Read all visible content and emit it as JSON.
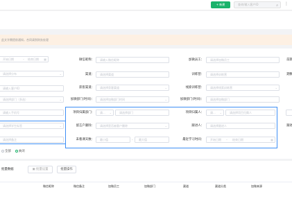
{
  "header": {
    "new_button": "+ 新建",
    "search_placeholder": "查询/输入客户ID",
    "menu_icon": "more-icon"
  },
  "notice": "此文字需提前通知，合同请到财务处理",
  "filters": {
    "left_column": [
      {
        "placeholder": "开始日期",
        "end_placeholder": "结束日期"
      },
      {
        "placeholder": "请选择分布"
      },
      {
        "placeholder": "请输入客户ID"
      },
      {
        "placeholder": "请选择部门（多选）"
      },
      {
        "placeholder": "请输入手机号"
      },
      {
        "placeholder": "请选择学生标签"
      },
      {
        "placeholder": "请选择备注"
      }
    ],
    "col2": [
      {
        "label": "微信昵称：",
        "placeholder": "请输入微信昵称"
      },
      {
        "label": "渠道：",
        "placeholder": "请选择渠道"
      },
      {
        "label": "获客渠道：",
        "placeholder": "请选择获客渠道"
      },
      {
        "label": "加微部门(时间)：",
        "placeholder": "请选择加微部门时间"
      },
      {
        "label": "项目归属部门：",
        "select": "请...",
        "placeholder": "请选择部门"
      },
      {
        "label": "留言户删除：",
        "placeholder": "请选择是否被客户删除"
      },
      {
        "label": "未看课天数：",
        "min": "最小值",
        "max": "最大值"
      }
    ],
    "col3": [
      {
        "label": "加微员工：",
        "placeholder": "请选择加微员工"
      },
      {
        "label": "训练营：",
        "placeholder": "请选择训练营"
      },
      {
        "label": "线索训练营：",
        "placeholder": "请选择线索训练营"
      },
      {
        "label": "加微部门(时间)：",
        "placeholder": "请选择加微部门"
      },
      {
        "label": "项目归属人：",
        "select": "请...",
        "placeholder": "请选择项目归属人"
      },
      {
        "label": "跟进人：",
        "placeholder": "请选择跟进人"
      },
      {
        "label": "最近学习时间：",
        "start": "开始日期",
        "end": "结束日期"
      }
    ],
    "col4": [
      {
        "label": "前期"
      },
      {
        "label": "期数"
      },
      {
        "label": "跟进"
      }
    ],
    "radio": {
      "options": [
        "全部",
        "关闭"
      ],
      "selected": 1
    }
  },
  "actions": {
    "left_label": "批量数据",
    "assign": "批量设置",
    "batch": "批量操作"
  },
  "table": {
    "columns": [
      "微信昵称",
      "微信备注",
      "加微员工",
      "加微部门",
      "渠道",
      "渠道分类",
      "加微来源"
    ]
  }
}
